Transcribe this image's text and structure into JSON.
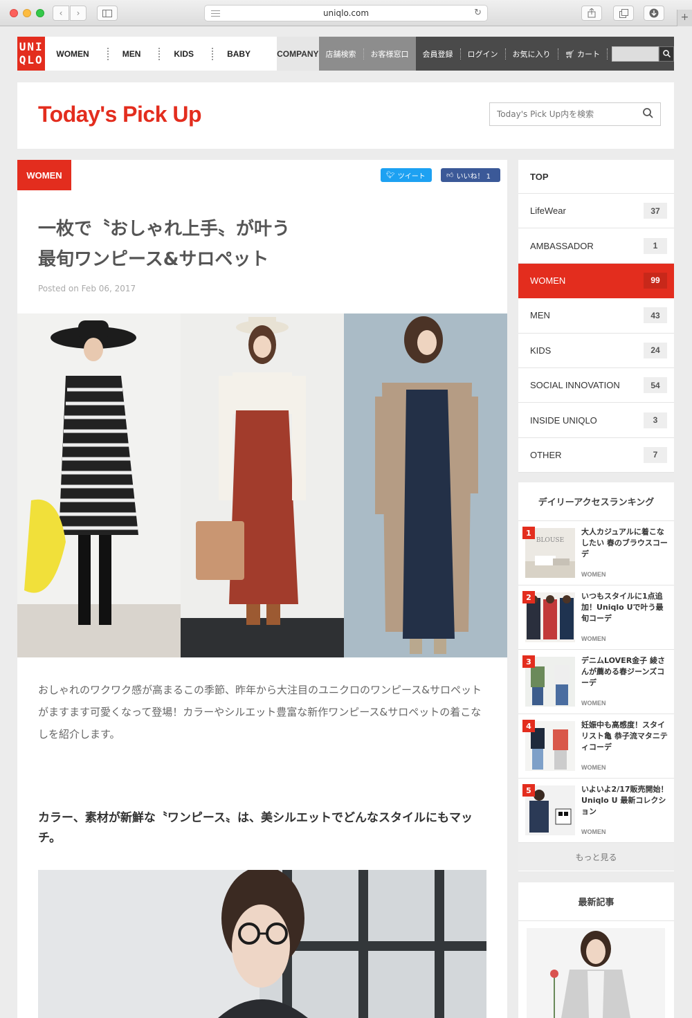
{
  "browser": {
    "url": "uniqlo.com"
  },
  "topnav": {
    "logo": [
      "UNI",
      "QLO"
    ],
    "links": [
      "WOMEN",
      "MEN",
      "KIDS",
      "BABY"
    ],
    "company": "COMPANY",
    "store_links": [
      "店舗検索",
      "お客様窓口"
    ],
    "account_links": [
      "会員登録",
      "ログイン",
      "お気に入り",
      "カート"
    ]
  },
  "header": {
    "title": "Today's Pick Up",
    "search_placeholder": "Today's Pick Up内を検索"
  },
  "article": {
    "category": "WOMEN",
    "tweet_label": "ツイート",
    "like_label": "いいね！ 1",
    "title_line1": "一枚で〝おしゃれ上手〟が叶う",
    "title_line2": "最旬ワンピース&サロペット",
    "posted": "Posted on Feb 06, 2017",
    "intro": "おしゃれのワクワク感が高まるこの季節、昨年から大注目のユニクロのワンピース&サロペットがますます可愛くなって登場！カラーやシルエット豊富な新作ワンピース&サロペットの着こなしを紹介します。",
    "subhead": "カラー、素材が新鮮な〝ワンピース〟は、美シルエットでどんなスタイルにもマッチ。"
  },
  "sidebar": {
    "top_label": "TOP",
    "categories": [
      {
        "label": "LifeWear",
        "count": "37"
      },
      {
        "label": "AMBASSADOR",
        "count": "1"
      },
      {
        "label": "WOMEN",
        "count": "99",
        "active": true
      },
      {
        "label": "MEN",
        "count": "43"
      },
      {
        "label": "KIDS",
        "count": "24"
      },
      {
        "label": "SOCIAL INNOVATION",
        "count": "54"
      },
      {
        "label": "INSIDE UNIQLO",
        "count": "3"
      },
      {
        "label": "OTHER",
        "count": "7"
      }
    ],
    "ranking_title": "デイリーアクセスランキング",
    "ranking": [
      {
        "num": "1",
        "title": "大人カジュアルに着こなしたい 春のブラウスコーデ",
        "cat": "WOMEN"
      },
      {
        "num": "2",
        "title": "いつもスタイルに1点追加！Uniqlo Uで叶う最旬コーデ",
        "cat": "WOMEN"
      },
      {
        "num": "3",
        "title": "デニムLOVER金子 綾さんが薦める春ジーンズコーデ",
        "cat": "WOMEN"
      },
      {
        "num": "4",
        "title": "妊娠中も高感度！スタイリスト亀 恭子流マタニティコーデ",
        "cat": "WOMEN"
      },
      {
        "num": "5",
        "title": "いよいよ2/17販売開始！Uniqlo U 最新コレクション",
        "cat": "WOMEN"
      }
    ],
    "ranking_thumb_text": "BLOUSE",
    "more_label": "もっと見る",
    "latest_title": "最新記事"
  },
  "colors": {
    "brand_red": "#e32d1e",
    "nav_dark": "#4a4a4a",
    "nav_gray": "#8d8d8d"
  }
}
